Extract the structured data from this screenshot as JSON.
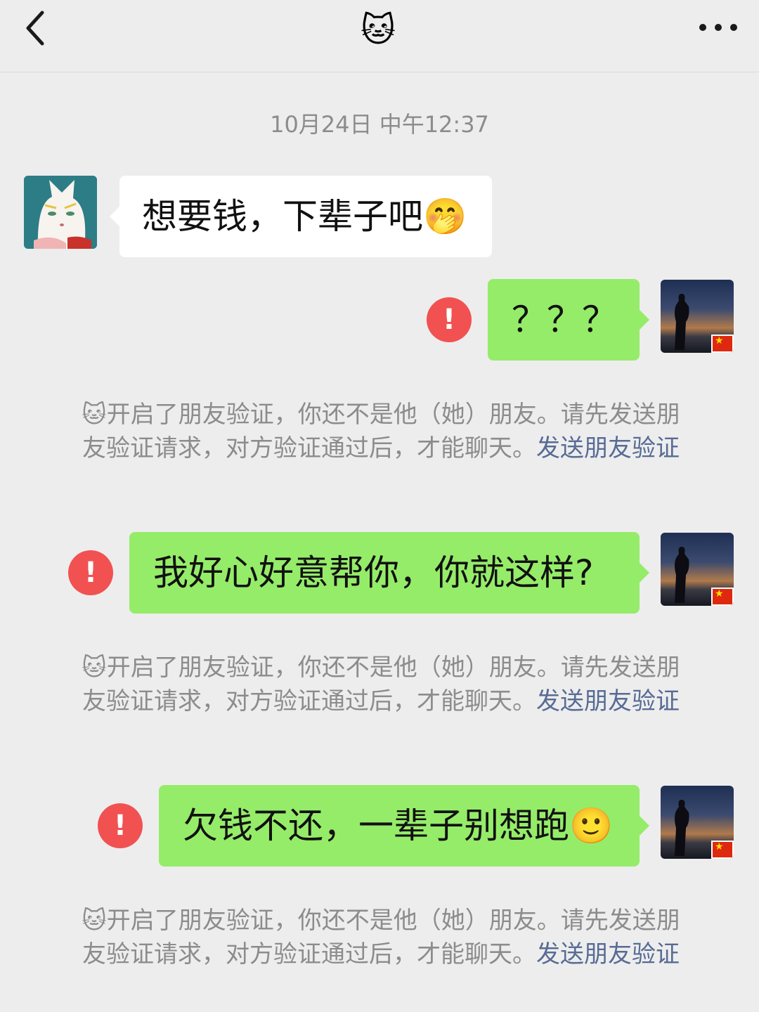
{
  "header": {
    "title_emoji": "🐱"
  },
  "timestamp": "10月24日 中午12:37",
  "messages": [
    {
      "text": "想要钱，下辈子吧🤭",
      "from": "them"
    },
    {
      "text": "？？？",
      "from": "me",
      "status": "!"
    },
    {
      "text": "我好心好意帮你，你就这样?",
      "from": "me",
      "status": "!"
    },
    {
      "text": "欠钱不还，一辈子别想跑🙂",
      "from": "me",
      "status": "!"
    }
  ],
  "notice": {
    "text": "🐱开启了朋友验证，你还不是他（她）朋友。请先发送朋友验证请求，对方验证通过后，才能聊天。",
    "link": "发送朋友验证"
  },
  "colors": {
    "my_bubble": "#95ec69",
    "their_bubble": "#ffffff",
    "error": "#f25151",
    "link": "#576b95",
    "background": "#ededed"
  },
  "icons": [
    "back-chevron-icon",
    "more-dots-icon",
    "error-icon",
    "china-flag-icon"
  ]
}
